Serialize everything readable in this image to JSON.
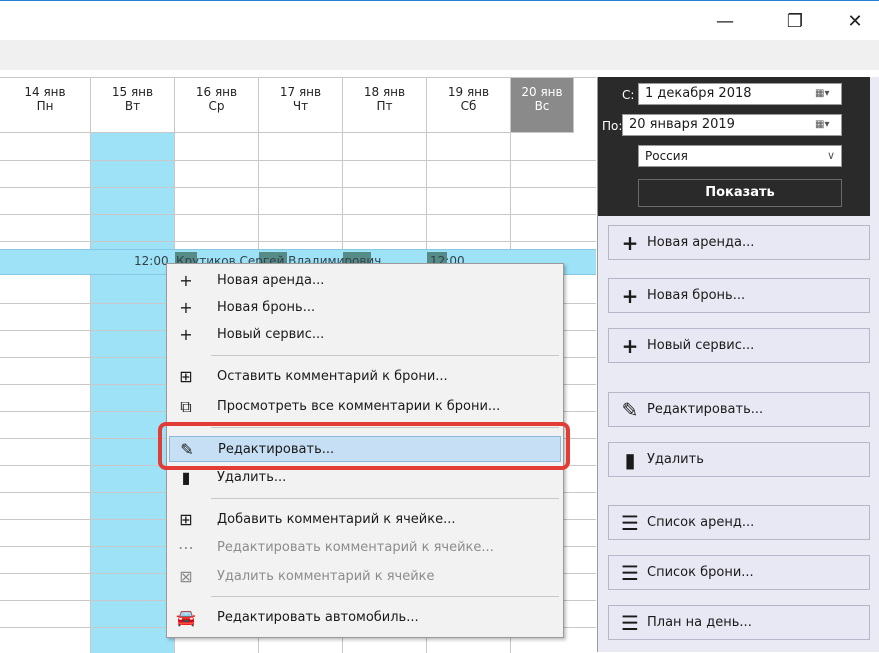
{
  "window": {
    "min": "—",
    "max": "❐",
    "close": "✕"
  },
  "calendar": {
    "days": [
      {
        "date": "14 янв",
        "dow": "Пн"
      },
      {
        "date": "15 янв",
        "dow": "Вт"
      },
      {
        "date": "16 янв",
        "dow": "Ср"
      },
      {
        "date": "17 янв",
        "dow": "Чт"
      },
      {
        "date": "18 янв",
        "dow": "Пт"
      },
      {
        "date": "19 янв",
        "dow": "Сб"
      },
      {
        "date": "20 янв",
        "dow": "Вс"
      }
    ],
    "event": {
      "start_time": "12:00",
      "label": "Крутиков Сергей Владимирович",
      "end_time": "12:00"
    }
  },
  "filter": {
    "from_label": "С:",
    "from_value": "1  декабря  2018",
    "to_label": "По:",
    "to_value": "20  января  2019",
    "country": "Россия",
    "show_button": "Показать",
    "calendar_icon": "calendar-icon"
  },
  "actions": [
    {
      "label": "Новая аренда...",
      "icon": "plus-icon"
    },
    {
      "label": "Новая бронь...",
      "icon": "plus-icon"
    },
    {
      "label": "Новый сервис...",
      "icon": "plus-icon"
    },
    {
      "label": "Редактировать...",
      "icon": "pencil-icon"
    },
    {
      "label": "Удалить",
      "icon": "trash-icon"
    },
    {
      "label": "Список аренд...",
      "icon": "list-icon"
    },
    {
      "label": "Список брони...",
      "icon": "list-icon"
    },
    {
      "label": "План на день...",
      "icon": "list-icon"
    }
  ],
  "context_menu": {
    "items": [
      {
        "label": "Новая аренда..."
      },
      {
        "label": "Новая бронь..."
      },
      {
        "label": "Новый сервис..."
      },
      {
        "label": "Оставить комментарий к брони..."
      },
      {
        "label": "Просмотреть все комментарии к брони..."
      },
      {
        "label": "Редактировать..."
      },
      {
        "label": "Удалить..."
      },
      {
        "label": "Добавить комментарий к ячейке..."
      },
      {
        "label": "Редактировать комментарий к ячейке..."
      },
      {
        "label": "Удалить комментарий к ячейке"
      },
      {
        "label": "Редактировать автомобиль..."
      }
    ],
    "highlighted": "Редактировать..."
  }
}
